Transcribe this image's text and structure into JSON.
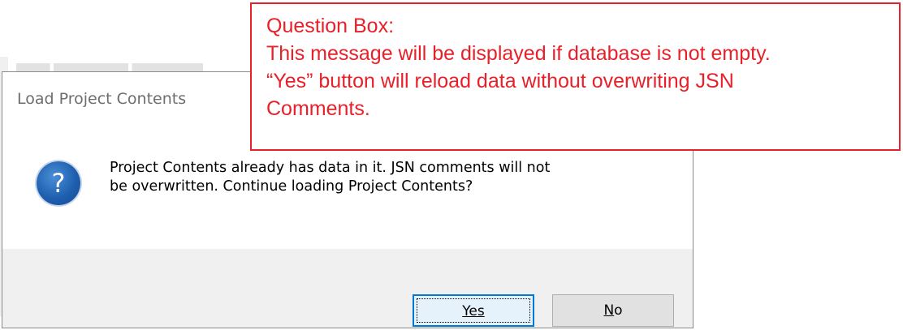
{
  "dialog": {
    "title": "Load Project Contents",
    "icon": "question-icon",
    "message_lines": [
      "Project Contents already has data in it.  JSN comments will not",
      "be overwritten.  Continue loading Project Contents?"
    ],
    "buttons": {
      "yes_label": "Yes",
      "no_label": "No"
    }
  },
  "annotation": {
    "lines": [
      "Question Box:",
      "This message will be displayed if database is not empty.",
      "“Yes” button will reload data without overwriting JSN",
      "Comments."
    ],
    "color": "#e8202a"
  },
  "colors": {
    "accent": "#0078d7",
    "footer_bg": "#f0f0f0",
    "icon_blue": "#1f5fb0"
  }
}
